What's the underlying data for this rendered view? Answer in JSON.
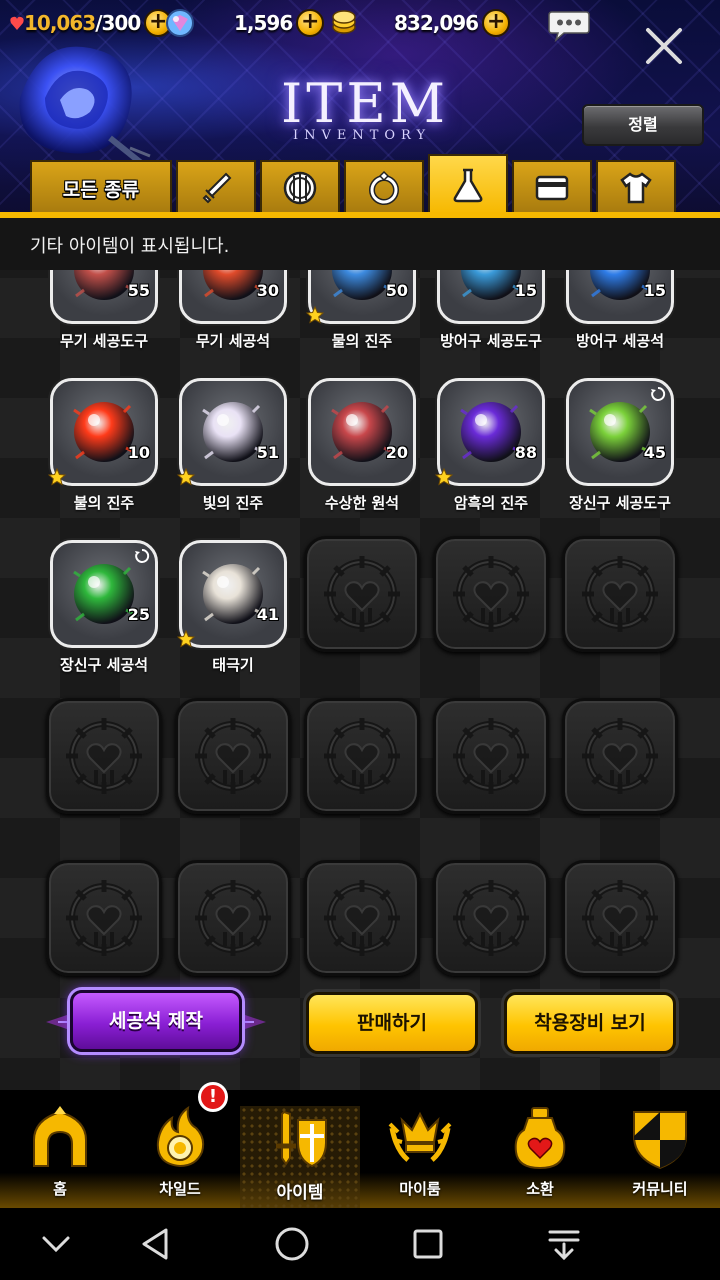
{
  "resources": {
    "stamina_value": "10,063",
    "stamina_max": "/300",
    "gems_value": "1,596",
    "gold_value": "832,096"
  },
  "header": {
    "title": "ITEM",
    "subtitle": "INVENTORY",
    "sort_button": "정렬"
  },
  "tabs": [
    {
      "label": "모든 종류",
      "icon": "all-types"
    },
    {
      "label": "",
      "icon": "sword-icon"
    },
    {
      "label": "",
      "icon": "shield-icon"
    },
    {
      "label": "",
      "icon": "ring-icon"
    },
    {
      "label": "",
      "icon": "flask-icon",
      "active": true
    },
    {
      "label": "",
      "icon": "card-icon"
    },
    {
      "label": "",
      "icon": "shirt-icon"
    }
  ],
  "notice": "기타 아이템이 표시됩니다.",
  "items": [
    {
      "name": "무기 세공도구",
      "count": "55",
      "star": false,
      "color": "#c2504a"
    },
    {
      "name": "무기 세공석",
      "count": "30",
      "star": false,
      "color": "#e04b2b"
    },
    {
      "name": "물의 진주",
      "count": "50",
      "star": true,
      "color": "#3d8be0"
    },
    {
      "name": "방어구 세공도구",
      "count": "15",
      "star": false,
      "color": "#3a9ad9"
    },
    {
      "name": "방어구 세공석",
      "count": "15",
      "star": false,
      "color": "#2f7de8"
    },
    {
      "name": "불의 진주",
      "count": "10",
      "star": true,
      "color": "#ff3b1a"
    },
    {
      "name": "빛의 진주",
      "count": "51",
      "star": true,
      "color": "#e9e2f5"
    },
    {
      "name": "수상한 원석",
      "count": "20",
      "star": false,
      "color": "#c8474b"
    },
    {
      "name": "암흑의 진주",
      "count": "88",
      "star": true,
      "color": "#6a2bd8"
    },
    {
      "name": "장신구 세공도구",
      "count": "45",
      "star": false,
      "color": "#7bd13a",
      "cycle": true
    },
    {
      "name": "장신구 세공석",
      "count": "25",
      "star": false,
      "color": "#2fb83c",
      "cycle": true
    },
    {
      "name": "태극기",
      "count": "41",
      "star": true,
      "color": "#e8e2d8"
    }
  ],
  "actions": {
    "craft": "세공석 제작",
    "sell": "판매하기",
    "equipment": "착용장비 보기"
  },
  "nav": [
    {
      "label": "홈",
      "icon": "home-icon"
    },
    {
      "label": "차일드",
      "icon": "child-icon",
      "badge": "!"
    },
    {
      "label": "아이템",
      "icon": "item-icon",
      "active": true
    },
    {
      "label": "마이룸",
      "icon": "myroom-icon"
    },
    {
      "label": "소환",
      "icon": "summon-icon"
    },
    {
      "label": "커뮤니티",
      "icon": "community-icon"
    }
  ],
  "colors": {
    "accent_gold": "#f6b800",
    "craft_purple": "#8a1fd4",
    "header_blue": "#12124d"
  }
}
